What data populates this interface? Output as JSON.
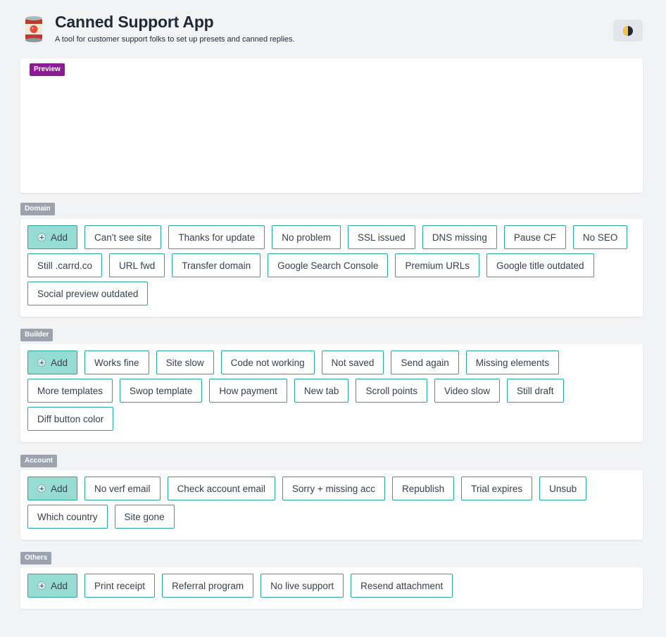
{
  "app": {
    "title": "Canned Support App",
    "subtitle": "A tool for customer support folks to set up presets and canned replies.",
    "logo_icon": "tomato-can-icon",
    "theme_icon": "half-moon-icon"
  },
  "preview": {
    "label": "Preview"
  },
  "colors": {
    "accent": "#2aa5a0",
    "add_bg": "#96dcd3",
    "preview_tag": "#8b1b94",
    "section_tag": "#9ca3af"
  },
  "sections": [
    {
      "label": "Domain",
      "add_label": "Add",
      "buttons": [
        "Can't see site",
        "Thanks for update",
        "No problem",
        "SSL issued",
        "DNS missing",
        "Pause CF",
        "No SEO",
        "Still .carrd.co",
        "URL fwd",
        "Transfer domain",
        "Google Search Console",
        "Premium URLs",
        "Google title outdated",
        "Social preview outdated"
      ]
    },
    {
      "label": "Builder",
      "add_label": "Add",
      "buttons": [
        "Works fine",
        "Site slow",
        "Code not working",
        "Not saved",
        "Send again",
        "Missing elements",
        "More templates",
        "Swop template",
        "How payment",
        "New tab",
        "Scroll points",
        "Video slow",
        "Still draft",
        "Diff button color"
      ]
    },
    {
      "label": "Account",
      "add_label": "Add",
      "buttons": [
        "No verf email",
        "Check account email",
        "Sorry + missing acc",
        "Republish",
        "Trial expires",
        "Unsub",
        "Which country",
        "Site gone"
      ]
    },
    {
      "label": "Others",
      "add_label": "Add",
      "buttons": [
        "Print receipt",
        "Referral program",
        "No live support",
        "Resend attachment"
      ]
    }
  ]
}
